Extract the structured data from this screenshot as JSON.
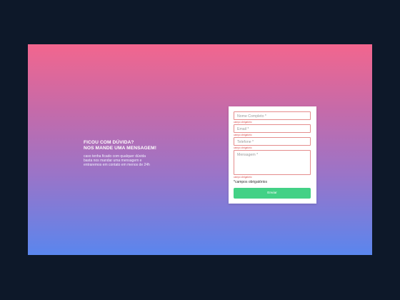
{
  "hero": {
    "title_line1": "FICOU COM DÚVIDA?",
    "title_line2": "NOS MANDE UMA MENSAGEM!",
    "description_line1": "caso tenha ficado com qualquer dúvida",
    "description_line2": "basta nos mandar uma mensagem e",
    "description_line3": "entraremos em contato em menos de 24h"
  },
  "form": {
    "name_placeholder": "Nome Completo *",
    "email_placeholder": "Email *",
    "phone_placeholder": "Telefone *",
    "message_placeholder": "Mensagem *",
    "required_error": "campo obrigatório",
    "required_note": "*campos obrigatórios",
    "submit_label": "Enviar"
  },
  "colors": {
    "background": "#0d1829",
    "gradient_top": "#f2668e",
    "gradient_bottom": "#5a86ee",
    "button": "#43d186",
    "error": "#d94a4a"
  }
}
